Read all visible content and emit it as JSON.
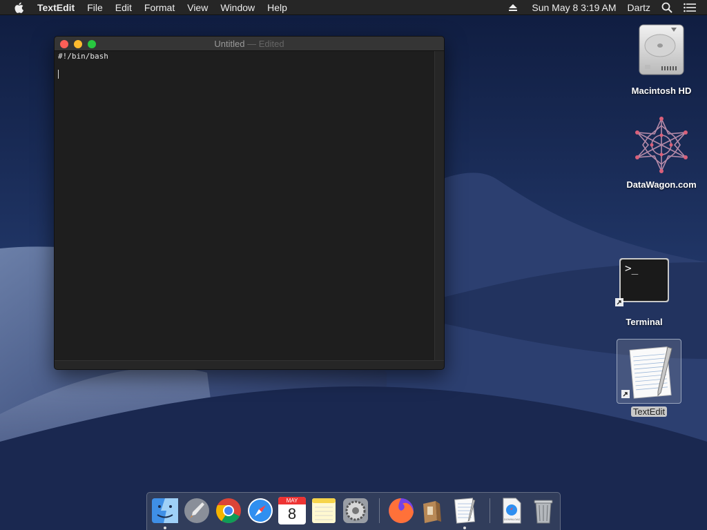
{
  "menubar": {
    "apple_icon": "apple-icon",
    "app_name": "TextEdit",
    "items": [
      "File",
      "Edit",
      "Format",
      "View",
      "Window",
      "Help"
    ],
    "clock": "Sun May 8  3:19 AM",
    "user": "Dartz"
  },
  "window": {
    "title": "Untitled",
    "title_separator": " — ",
    "status": "Edited",
    "lines": [
      "#!/bin/bash",
      ""
    ]
  },
  "desktop": {
    "icons": [
      {
        "label": "Macintosh HD",
        "icon": "hard-drive-icon"
      },
      {
        "label": "DataWagon.com",
        "icon": "network-star-icon"
      },
      {
        "label": "Terminal",
        "icon": "terminal-icon"
      },
      {
        "label": "TextEdit",
        "icon": "textedit-icon"
      }
    ]
  },
  "dock": {
    "calendar_month": "MAY",
    "calendar_day": "8",
    "download_label": "DOWNLOAD"
  },
  "colors": {
    "menubar": "#262626",
    "window_bg": "#1e1e1e",
    "close": "#fd5f57",
    "minimize": "#febb2e",
    "maximize": "#28c840",
    "wallpaper": "#1b2a52"
  }
}
